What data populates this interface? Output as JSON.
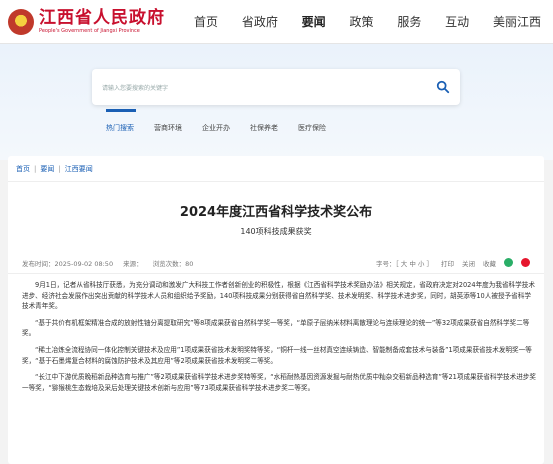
{
  "header": {
    "logo_cn": "江西省人民政府",
    "logo_en": "People's Government of Jiangxi Province",
    "nav": [
      "首页",
      "省政府",
      "要闻",
      "政策",
      "服务",
      "互动",
      "美丽江西"
    ],
    "active_nav": "要闻"
  },
  "search": {
    "placeholder": "请输入您要搜索的关键字"
  },
  "quick_links": [
    "热门搜索",
    "营商环境",
    "企业开办",
    "社保养老",
    "医疗保险"
  ],
  "breadcrumb": [
    "首页",
    "要闻",
    "江西要闻"
  ],
  "article": {
    "title": "2024年度江西省科学技术奖公布",
    "subtitle": "140项科技成果获奖",
    "publish_time": "发布时间：2025-09-02 08:50",
    "source": "来源：",
    "views": "浏览次数：80",
    "font_size": "字号：［ 大  中  小 ］",
    "print": "打印",
    "close": "关闭",
    "favorite": "收藏",
    "paragraphs": [
      "9月1日，记者从省科技厅获悉，为充分调动和激发广大科技工作者创新创业的积极性，根据《江西省科学技术奖励办法》相关规定，省政府决定对2024年度为我省科学技术进步、经济社会发展作出突出贡献的科学技术人员和组织给予奖励，140项科技成果分别获得省自然科学奖、技术发明奖、科学技术进步奖，同时，胡英添等10人被授予省科学技术青年奖。",
      "“基于共价有机框架精准合成的放射性铀分离提取研究”等8项成果获省自然科学奖一等奖，“单原子层纳米材料离散理论与连续理论的统一”等32项成果获省自然科学奖二等奖。",
      "“稀土冶炼全流程协同一体化控制关键技术及应用”1项成果获省技术发明奖特等奖，“铜杆一线一丝材真空连续铸造、智能制备成套技术与装备”1项成果获省技术发明奖一等奖，“基于石墨烯复合材料的腐蚀防护技术及其应用”等2项成果获省技术发明奖二等奖。",
      "“长江中下游优质晚稻新品种选育与推广”等2项成果获省科学技术进步奖特等奖，“水稻耐热基因资源发掘与耐热优质中籼杂交稻新品种选育”等21项成果获省科学技术进步奖一等奖，“猕猴桃生态栽培及采后处理关键技术创新与应用”等73项成果获省科学技术进步奖二等奖。"
    ]
  },
  "colors": {
    "brand_red": "#c8102e",
    "link_blue": "#1a5fb4"
  }
}
